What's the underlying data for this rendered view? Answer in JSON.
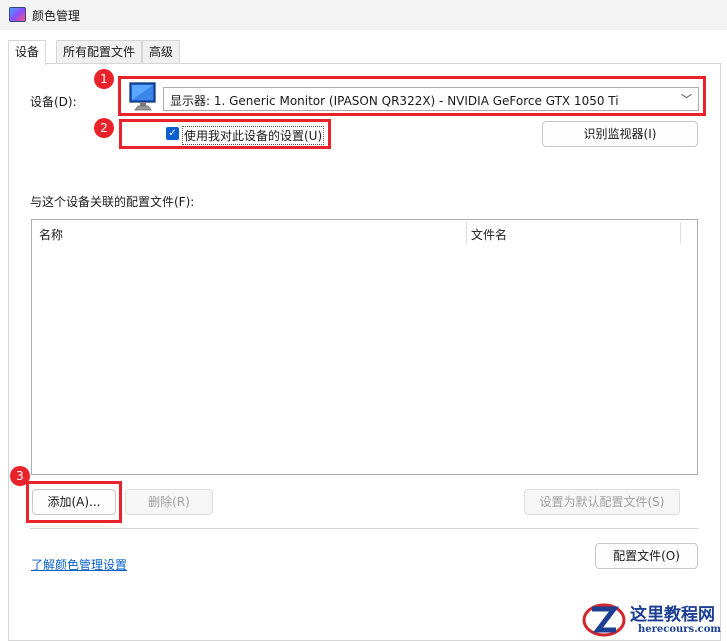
{
  "window": {
    "title": "颜色管理"
  },
  "tabs": [
    {
      "label": "设备"
    },
    {
      "label": "所有配置文件"
    },
    {
      "label": "高级"
    }
  ],
  "device": {
    "label": "设备(D):",
    "selected": "显示器: 1. Generic Monitor (IPASON QR322X) - NVIDIA GeForce GTX 1050 Ti",
    "use_settings_label": "使用我对此设备的设置(U)",
    "use_settings_checked": true,
    "identify_button": "识别监视器(I)"
  },
  "profiles": {
    "label": "与这个设备关联的配置文件(F):",
    "columns": [
      "名称",
      "文件名"
    ],
    "rows": []
  },
  "buttons": {
    "add": "添加(A)...",
    "remove": "删除(R)",
    "set_default": "设置为默认配置文件(S)",
    "profiles": "配置文件(O)"
  },
  "link": "了解颜色管理设置",
  "annotations": [
    "1",
    "2",
    "3"
  ],
  "watermark": {
    "title": "这里教程网",
    "url": "herecours.com"
  },
  "colors": {
    "highlight": "#e8232b",
    "link": "#0a61c9",
    "accent": "#0c5fd1"
  }
}
